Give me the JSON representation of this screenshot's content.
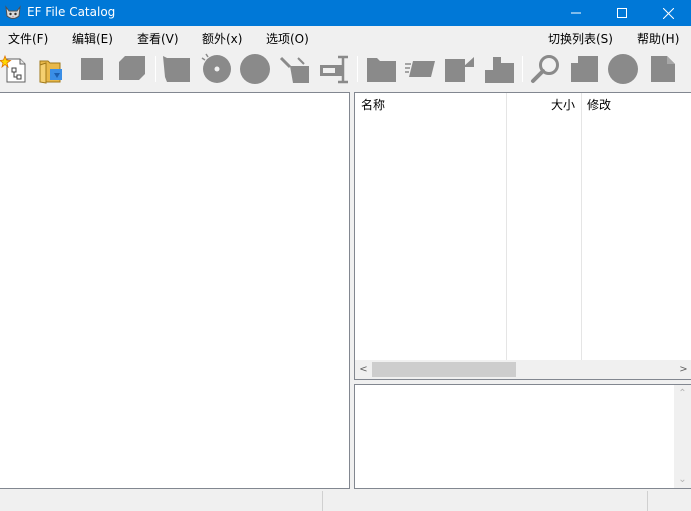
{
  "window": {
    "title": "EF File Catalog",
    "minimize_label": "—",
    "maximize_label": "☐",
    "close_label": "✕"
  },
  "menu": {
    "items": [
      "文件(F)",
      "编辑(E)",
      "查看(V)",
      "额外(x)",
      "选项(O)"
    ],
    "right_items": [
      "切换列表(S)",
      "帮助(H)"
    ]
  },
  "toolbar": {
    "buttons": [
      {
        "icon": "new-catalog-icon"
      },
      {
        "icon": "open-folder-icon"
      },
      {
        "icon": "square-icon"
      },
      {
        "icon": "copy-stack-icon"
      },
      {
        "icon": "drive-icon"
      },
      {
        "icon": "cd-disc-icon"
      },
      {
        "icon": "disk-icon"
      },
      {
        "icon": "cut-icon"
      },
      {
        "icon": "rename-icon"
      },
      {
        "icon": "folder-icon"
      },
      {
        "icon": "tape-icon"
      },
      {
        "icon": "tag-icon"
      },
      {
        "icon": "puzzle-icon"
      },
      {
        "icon": "search-icon"
      },
      {
        "icon": "document-stack-icon"
      },
      {
        "icon": "circle-icon"
      },
      {
        "icon": "document-icon"
      }
    ]
  },
  "file_list": {
    "columns": {
      "name": "名称",
      "size": "大小",
      "modified": "修改"
    },
    "rows": []
  },
  "scrollbar": {
    "left_arrow": "<",
    "right_arrow": ">",
    "up_arrow": "⌃",
    "down_arrow": "⌄"
  },
  "colors": {
    "titlebar": "#0078d7",
    "disabled_icon": "#8a8a8a"
  }
}
